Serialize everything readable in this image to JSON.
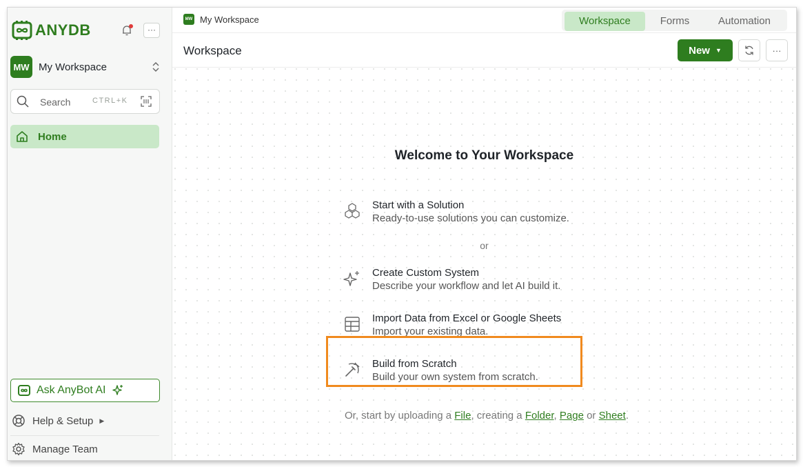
{
  "sidebar": {
    "logo_text": "ANYDB",
    "workspace": {
      "initials": "MW",
      "name": "My Workspace"
    },
    "search": {
      "placeholder": "Search",
      "shortcut": "CTRL+K"
    },
    "nav": {
      "home": "Home"
    },
    "ask_button": "Ask AnyBot AI",
    "help": "Help & Setup",
    "manage_team": "Manage Team"
  },
  "topbar": {
    "breadcrumb": {
      "initials": "MW",
      "label": "My Workspace"
    },
    "tabs": [
      {
        "label": "Workspace",
        "active": true
      },
      {
        "label": "Forms",
        "active": false
      },
      {
        "label": "Automation",
        "active": false
      }
    ]
  },
  "header": {
    "title": "Workspace",
    "new_button": "New"
  },
  "main": {
    "welcome": "Welcome to Your Workspace",
    "or_text": "or",
    "options": [
      {
        "title": "Start with a Solution",
        "desc": "Ready-to-use solutions you can customize.",
        "icon": "cubes-icon"
      },
      {
        "title": "Create Custom System",
        "desc": "Describe your workflow and let AI build it.",
        "icon": "sparkles-icon"
      },
      {
        "title": "Import Data from Excel or Google Sheets",
        "desc": "Import your existing data.",
        "icon": "table-icon"
      },
      {
        "title": "Build from Scratch",
        "desc": "Build your own system from scratch.",
        "icon": "pickaxe-icon"
      }
    ],
    "footer": {
      "prefix": "Or, start by uploading a ",
      "file": "File",
      "mid1": ", creating a ",
      "folder": "Folder",
      "comma": ", ",
      "page": "Page",
      "mid2": " or ",
      "sheet": "Sheet",
      "end": "."
    }
  },
  "colors": {
    "brand": "#2e7d1f",
    "brand_light": "#c9e8c8",
    "highlight": "#f08a1e",
    "notification": "#e03a3a"
  }
}
